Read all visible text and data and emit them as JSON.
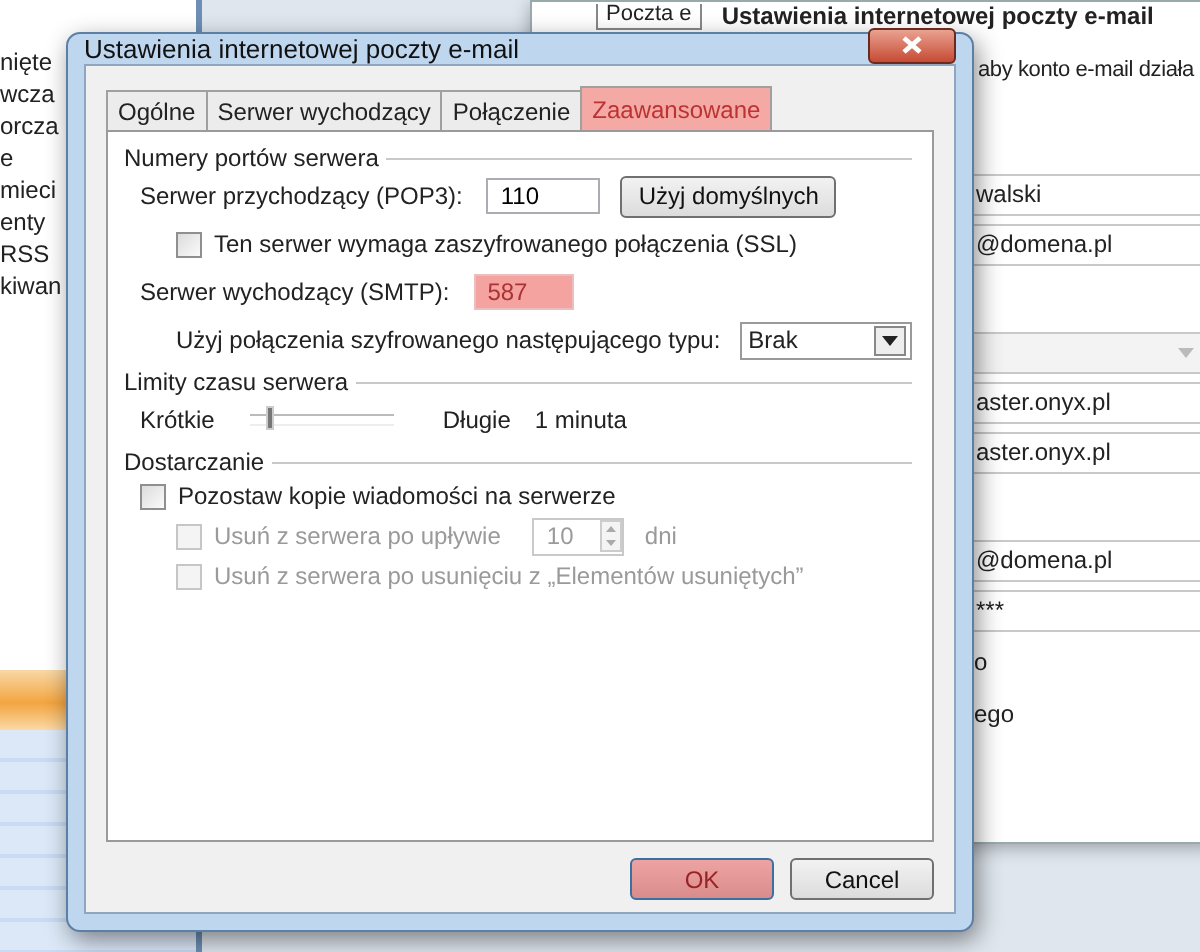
{
  "background": {
    "sidebar_items": [
      "nięte",
      "wcza",
      "orcza",
      "e",
      "mieci",
      "enty",
      "RSS",
      "kiwan"
    ],
    "tab": "Poczta e",
    "heading": "Ustawienia internetowej poczty e-mail",
    "description": "aby konto e-mail działa",
    "fields": [
      {
        "kind": "field",
        "value": "walski"
      },
      {
        "kind": "field",
        "value": "@domena.pl"
      },
      {
        "kind": "gap"
      },
      {
        "kind": "dropdown"
      },
      {
        "kind": "field",
        "value": "aster.onyx.pl"
      },
      {
        "kind": "field",
        "value": "aster.onyx.pl"
      },
      {
        "kind": "gap"
      },
      {
        "kind": "field",
        "value": "@domena.pl"
      },
      {
        "kind": "field",
        "value": "***"
      },
      {
        "kind": "text",
        "value": "o"
      },
      {
        "kind": "text",
        "value": "ego"
      }
    ]
  },
  "dialog": {
    "title": "Ustawienia internetowej poczty e-mail",
    "tabs": [
      {
        "label": "Ogólne",
        "selected": false,
        "highlighted": false
      },
      {
        "label": "Serwer wychodzący",
        "selected": false,
        "highlighted": false
      },
      {
        "label": "Połączenie",
        "selected": false,
        "highlighted": false
      },
      {
        "label": "Zaawansowane",
        "selected": true,
        "highlighted": true
      }
    ],
    "ports": {
      "title": "Numery portów serwera",
      "incoming_label": "Serwer przychodzący (POP3):",
      "incoming_value": "110",
      "default_button": "Użyj domyślnych",
      "ssl": {
        "label": "Ten serwer wymaga zaszyfrowanego połączenia (SSL)",
        "checked": false
      },
      "outgoing_label": "Serwer wychodzący (SMTP):",
      "outgoing_value": "587",
      "outgoing_highlighted": true,
      "encryption_label": "Użyj połączenia szyfrowanego następującego typu:",
      "encryption_value": "Brak"
    },
    "timeouts": {
      "title": "Limity czasu serwera",
      "short_label": "Krótkie",
      "level": 0.1,
      "long_label": "Długie",
      "reading": "1 minuta"
    },
    "delivery": {
      "title": "Dostarczanie",
      "leave_copy": {
        "label": "Pozostaw kopie wiadomości na serwerze",
        "checked": false
      },
      "remove_after": {
        "label": "Usuń z serwera po upływie",
        "checked": false,
        "disabled": true,
        "value": "10",
        "unit": "dni"
      },
      "remove_deleted": {
        "label": "Usuń z serwera po usunięciu z „Elementów usuniętych”",
        "checked": false,
        "disabled": true
      }
    },
    "buttons": [
      {
        "label": "OK",
        "highlighted": true
      },
      {
        "label": "Cancel",
        "highlighted": false
      }
    ]
  }
}
